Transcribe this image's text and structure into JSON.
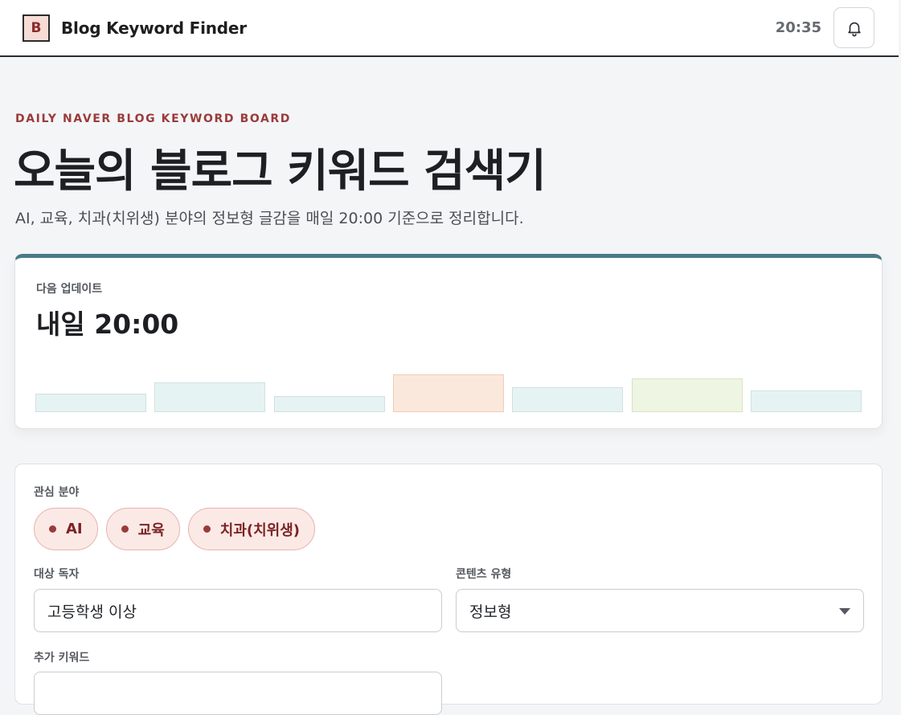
{
  "header": {
    "logo_letter": "B",
    "app_name": "Blog Keyword Finder",
    "clock": "20:35",
    "bell_icon": "bell-icon"
  },
  "hero": {
    "eyebrow": "DAILY NAVER BLOG KEYWORD BOARD",
    "title": "오늘의 블로그 키워드 검색기",
    "subtitle": "AI, 교육, 치과(치위생) 분야의 정보형 글감을 매일 20:00 기준으로 정리합니다."
  },
  "update": {
    "label": "다음 업데이트",
    "time": "내일 20:00",
    "bars": [
      {
        "level": 0.48,
        "tone": "teal"
      },
      {
        "level": 0.78,
        "tone": "teal"
      },
      {
        "level": 0.43,
        "tone": "teal"
      },
      {
        "level": 1.0,
        "tone": "peach"
      },
      {
        "level": 0.65,
        "tone": "teal"
      },
      {
        "level": 0.89,
        "tone": "green"
      },
      {
        "level": 0.57,
        "tone": "teal"
      }
    ]
  },
  "settings": {
    "interests_label": "관심 분야",
    "interests": [
      {
        "label": "AI"
      },
      {
        "label": "교육"
      },
      {
        "label": "치과(치위생)"
      }
    ],
    "audience_label": "대상 독자",
    "audience_value": "고등학생 이상",
    "content_type_label": "콘텐츠 유형",
    "content_type_value": "정보형",
    "extra_keywords_label": "추가 키워드",
    "extra_keywords_value": ""
  },
  "colors": {
    "accent": "#9a3b3b",
    "card_top_border": "#4a7a86",
    "chip_bg": "#fbe9e6"
  }
}
